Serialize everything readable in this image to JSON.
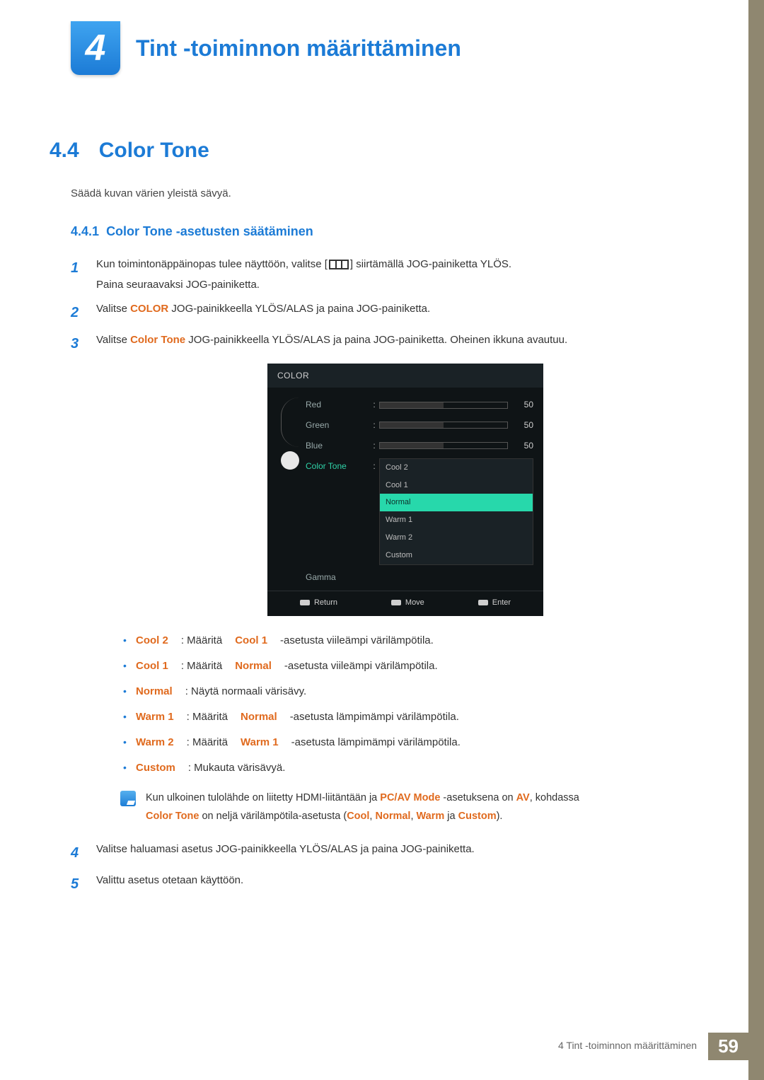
{
  "chapter": {
    "number": "4",
    "title": "Tint -toiminnon määrittäminen"
  },
  "section": {
    "number": "4.4",
    "title": "Color Tone"
  },
  "intro": "Säädä kuvan värien yleistä sävyä.",
  "subsection": {
    "number": "4.4.1",
    "title": "Color Tone -asetusten säätäminen"
  },
  "steps": {
    "s1a": "Kun toimintonäppäinopas tulee näyttöön, valitse [",
    "s1b": "] siirtämällä JOG-painiketta YLÖS.",
    "s1c": "Paina seuraavaksi JOG-painiketta.",
    "s2a": "Valitse ",
    "s2_hl": "COLOR",
    "s2b": " JOG-painikkeella YLÖS/ALAS ja paina JOG-painiketta.",
    "s3a": "Valitse ",
    "s3_hl": "Color Tone",
    "s3b": " JOG-painikkeella YLÖS/ALAS ja paina JOG-painiketta. Oheinen ikkuna avautuu.",
    "s4": "Valitse haluamasi asetus JOG-painikkeella YLÖS/ALAS ja paina JOG-painiketta.",
    "s5": "Valittu asetus otetaan käyttöön."
  },
  "osd": {
    "title": "COLOR",
    "rows": {
      "red": {
        "label": "Red",
        "value": "50"
      },
      "green": {
        "label": "Green",
        "value": "50"
      },
      "blue": {
        "label": "Blue",
        "value": "50"
      },
      "tone": {
        "label": "Color Tone"
      },
      "gamma": {
        "label": "Gamma"
      }
    },
    "options": {
      "o1": "Cool 2",
      "o2": "Cool 1",
      "o3": "Normal",
      "o4": "Warm 1",
      "o5": "Warm 2",
      "o6": "Custom"
    },
    "footer": {
      "return": "Return",
      "move": "Move",
      "enter": "Enter"
    }
  },
  "bullets": {
    "b1_hl": "Cool 2",
    "b1_a": ": Määritä ",
    "b1_hl2": "Cool 1",
    "b1_b": "-asetusta viileämpi värilämpötila.",
    "b2_hl": "Cool 1",
    "b2_a": ": Määritä ",
    "b2_hl2": "Normal",
    "b2_b": "-asetusta viileämpi värilämpötila.",
    "b3_hl": "Normal",
    "b3_a": ": Näytä normaali värisävy.",
    "b4_hl": "Warm 1",
    "b4_a": ": Määritä ",
    "b4_hl2": "Normal",
    "b4_b": "-asetusta lämpimämpi värilämpötila.",
    "b5_hl": "Warm 2",
    "b5_a": ": Määritä ",
    "b5_hl2": "Warm 1",
    "b5_b": "-asetusta lämpimämpi värilämpötila.",
    "b6_hl": "Custom",
    "b6_a": ": Mukauta värisävyä."
  },
  "note": {
    "a": "Kun ulkoinen tulolähde on liitetty HDMI-liitäntään ja ",
    "hl1": "PC/AV Mode",
    "b": " -asetuksena on ",
    "hl2": "AV",
    "c": ", kohdassa ",
    "hl3": "Color Tone",
    "d": " on neljä värilämpötila-asetusta (",
    "hl4": "Cool",
    "sep1": ", ",
    "hl5": "Normal",
    "sep2": ", ",
    "hl6": "Warm",
    "sep3": " ja ",
    "hl7": "Custom",
    "e": ")."
  },
  "footer": {
    "text": "4 Tint -toiminnon määrittäminen",
    "page": "59"
  }
}
